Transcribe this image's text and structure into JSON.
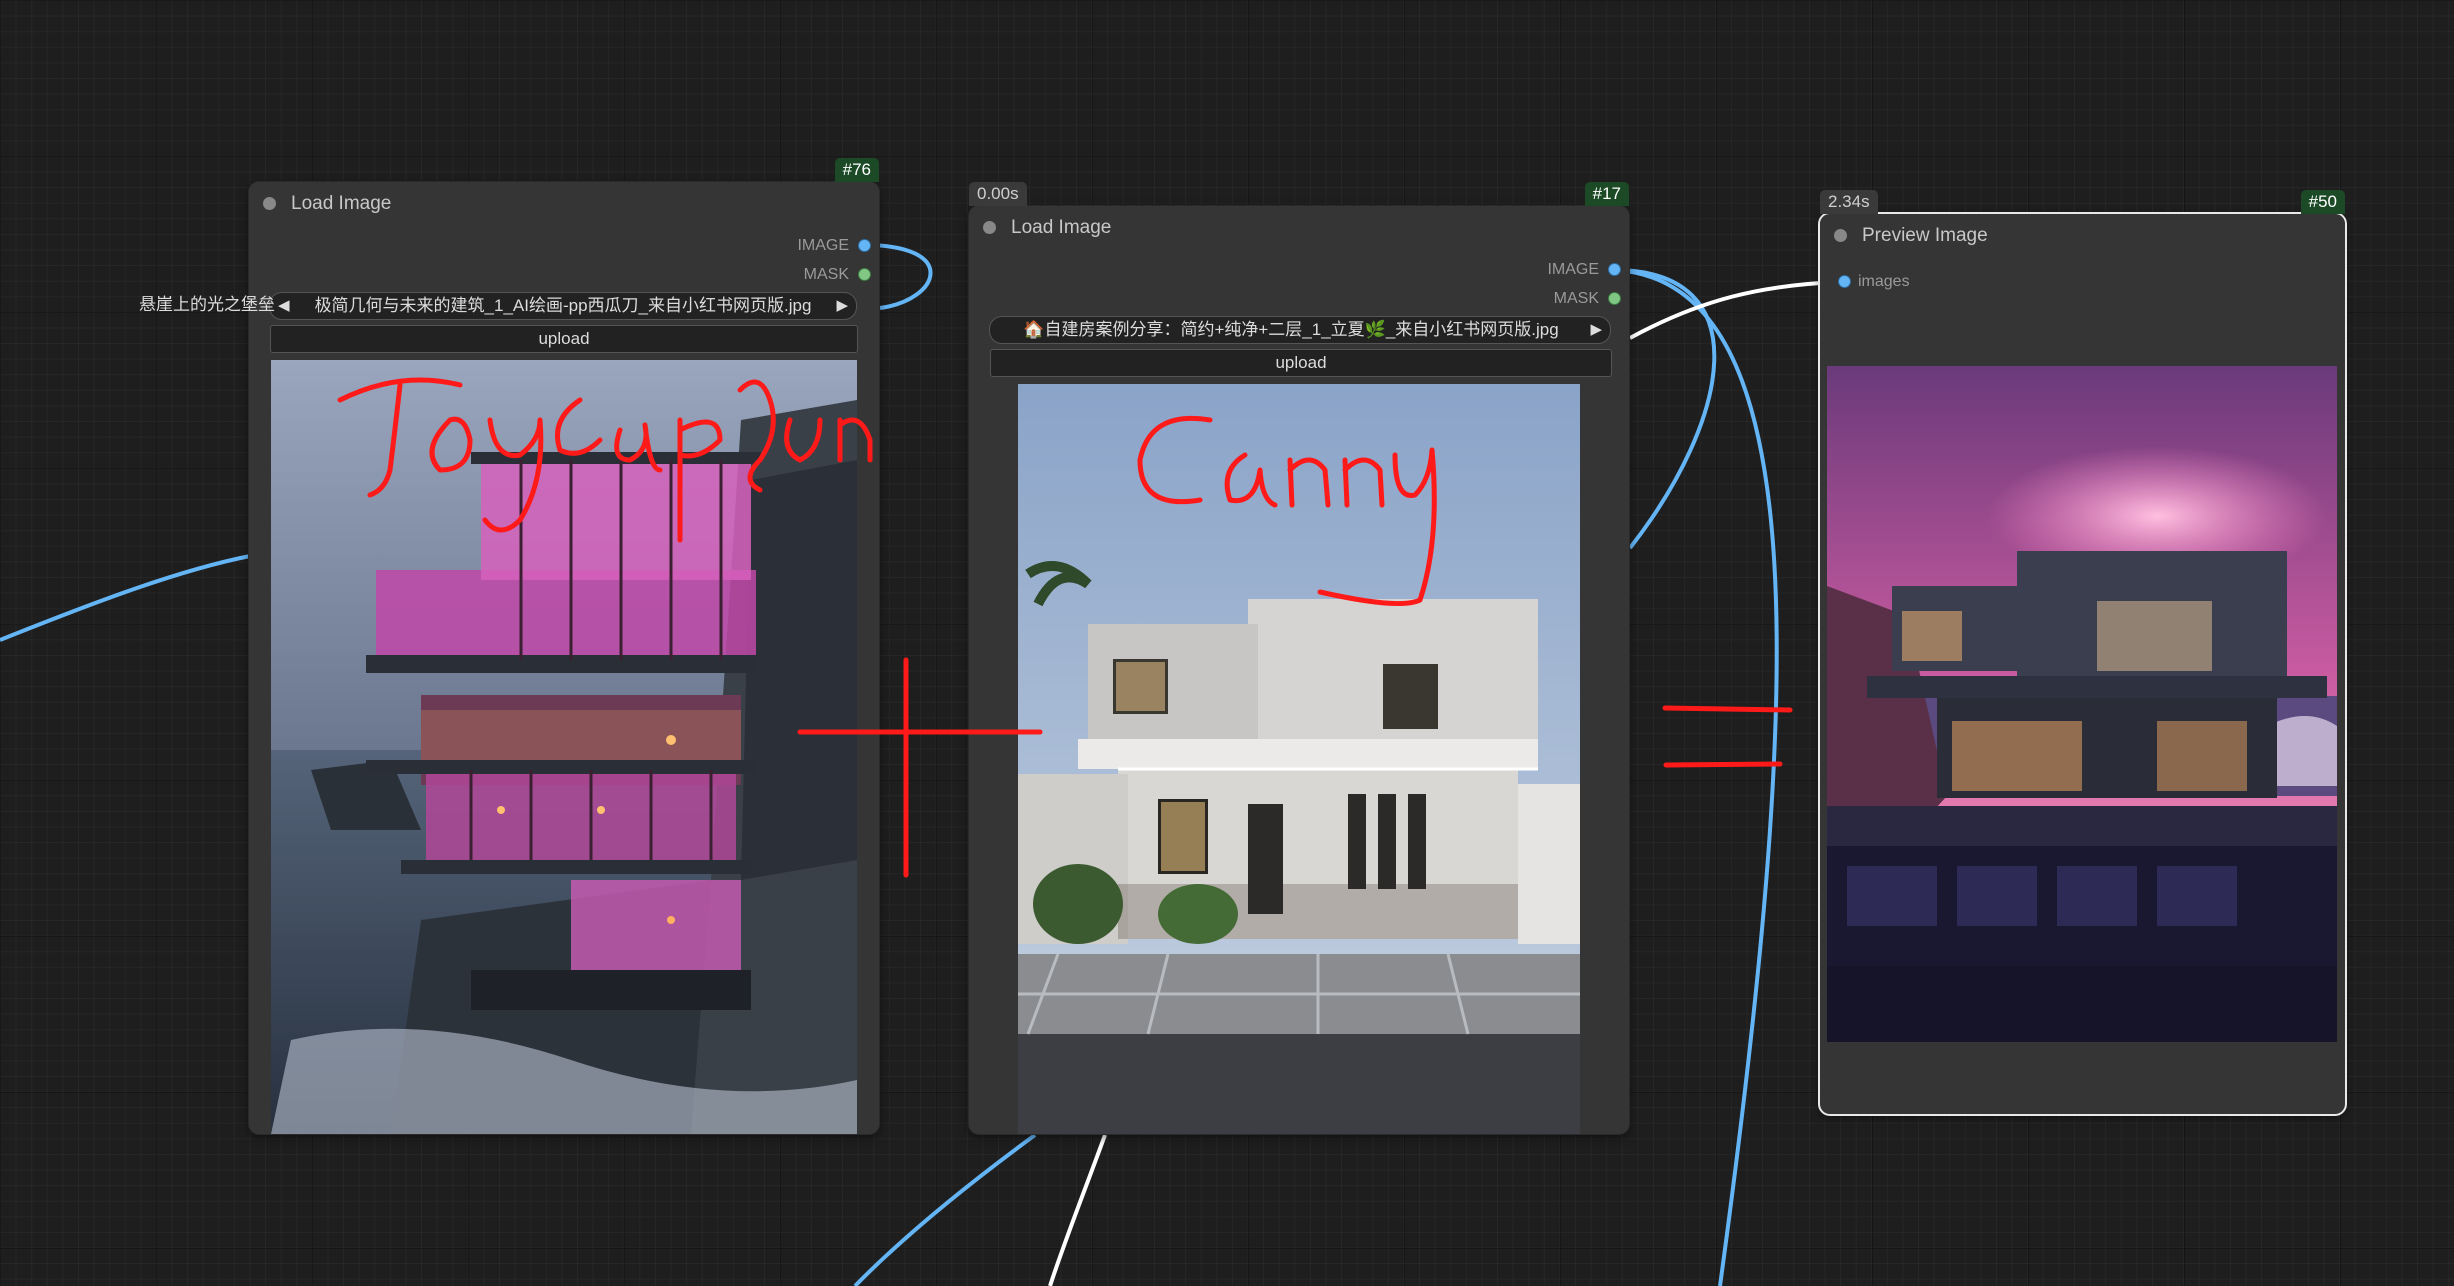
{
  "nodes": [
    {
      "id_badge": "#76",
      "title": "Load Image",
      "outputs": [
        "IMAGE",
        "MASK"
      ],
      "file": "悬崖上的光之堡垒：极简几何与未来的建筑_1_AI绘画-pp西瓜刀_来自小红书网页版.jpg",
      "file_visible": "极简几何与未来的建筑_1_AI绘画-pp西瓜刀_来自小红书网页版.jpg",
      "file_overflow": "悬崖上的光之堡垒",
      "upload_label": "upload",
      "annotation": "Joycaption"
    },
    {
      "id_badge": "#17",
      "time_badge": "0.00s",
      "title": "Load Image",
      "outputs": [
        "IMAGE",
        "MASK"
      ],
      "file": "🏠自建房案例分享：简约+纯净+二层_1_立夏🌿_来自小红书网页版.jpg",
      "upload_label": "upload",
      "annotation": "Canny"
    },
    {
      "id_badge": "#50",
      "time_badge": "2.34s",
      "title": "Preview Image",
      "inputs": [
        "images"
      ]
    }
  ],
  "colors": {
    "image_link": "#64b5f6",
    "mask_link": "#81c784",
    "annotation": "#ff1a1a",
    "selected_outline": "#e8e8e8"
  }
}
